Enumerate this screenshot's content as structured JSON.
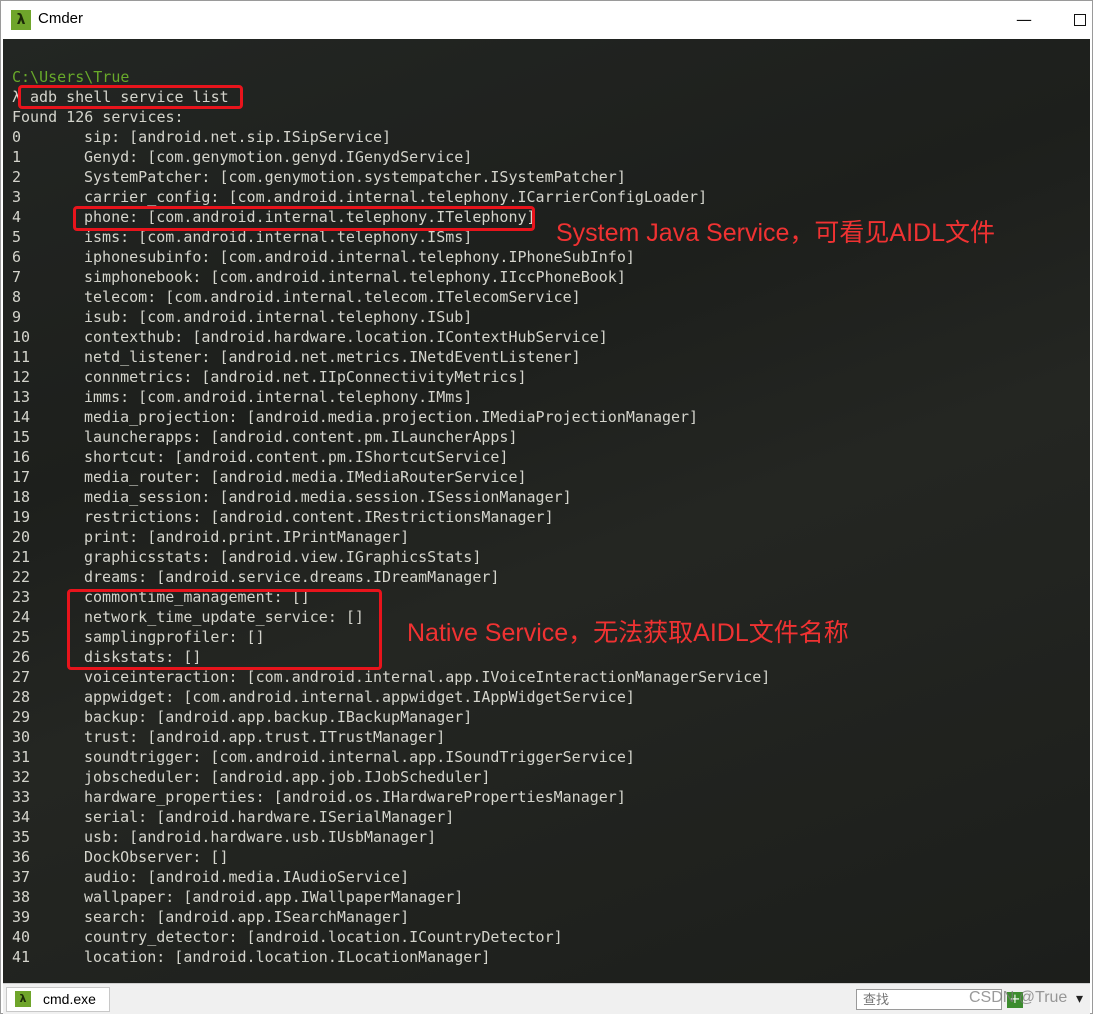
{
  "window": {
    "title": "Cmder",
    "app_icon_glyph": "λ",
    "minimize_glyph": "—"
  },
  "console": {
    "path_line": "C:\\Users\\True",
    "prompt": "λ",
    "command": "adb shell service list",
    "found_line": "Found 126 services:",
    "services": [
      {
        "index": "0",
        "text": "sip: [android.net.sip.ISipService]"
      },
      {
        "index": "1",
        "text": "Genyd: [com.genymotion.genyd.IGenydService]"
      },
      {
        "index": "2",
        "text": "SystemPatcher: [com.genymotion.systempatcher.ISystemPatcher]"
      },
      {
        "index": "3",
        "text": "carrier_config: [com.android.internal.telephony.ICarrierConfigLoader]"
      },
      {
        "index": "4",
        "text": "phone: [com.android.internal.telephony.ITelephony]"
      },
      {
        "index": "5",
        "text": "isms: [com.android.internal.telephony.ISms]"
      },
      {
        "index": "6",
        "text": "iphonesubinfo: [com.android.internal.telephony.IPhoneSubInfo]"
      },
      {
        "index": "7",
        "text": "simphonebook: [com.android.internal.telephony.IIccPhoneBook]"
      },
      {
        "index": "8",
        "text": "telecom: [com.android.internal.telecom.ITelecomService]"
      },
      {
        "index": "9",
        "text": "isub: [com.android.internal.telephony.ISub]"
      },
      {
        "index": "10",
        "text": "contexthub: [android.hardware.location.IContextHubService]"
      },
      {
        "index": "11",
        "text": "netd_listener: [android.net.metrics.INetdEventListener]"
      },
      {
        "index": "12",
        "text": "connmetrics: [android.net.IIpConnectivityMetrics]"
      },
      {
        "index": "13",
        "text": "imms: [com.android.internal.telephony.IMms]"
      },
      {
        "index": "14",
        "text": "media_projection: [android.media.projection.IMediaProjectionManager]"
      },
      {
        "index": "15",
        "text": "launcherapps: [android.content.pm.ILauncherApps]"
      },
      {
        "index": "16",
        "text": "shortcut: [android.content.pm.IShortcutService]"
      },
      {
        "index": "17",
        "text": "media_router: [android.media.IMediaRouterService]"
      },
      {
        "index": "18",
        "text": "media_session: [android.media.session.ISessionManager]"
      },
      {
        "index": "19",
        "text": "restrictions: [android.content.IRestrictionsManager]"
      },
      {
        "index": "20",
        "text": "print: [android.print.IPrintManager]"
      },
      {
        "index": "21",
        "text": "graphicsstats: [android.view.IGraphicsStats]"
      },
      {
        "index": "22",
        "text": "dreams: [android.service.dreams.IDreamManager]"
      },
      {
        "index": "23",
        "text": "commontime_management: []"
      },
      {
        "index": "24",
        "text": "network_time_update_service: []"
      },
      {
        "index": "25",
        "text": "samplingprofiler: []"
      },
      {
        "index": "26",
        "text": "diskstats: []"
      },
      {
        "index": "27",
        "text": "voiceinteraction: [com.android.internal.app.IVoiceInteractionManagerService]"
      },
      {
        "index": "28",
        "text": "appwidget: [com.android.internal.appwidget.IAppWidgetService]"
      },
      {
        "index": "29",
        "text": "backup: [android.app.backup.IBackupManager]"
      },
      {
        "index": "30",
        "text": "trust: [android.app.trust.ITrustManager]"
      },
      {
        "index": "31",
        "text": "soundtrigger: [com.android.internal.app.ISoundTriggerService]"
      },
      {
        "index": "32",
        "text": "jobscheduler: [android.app.job.IJobScheduler]"
      },
      {
        "index": "33",
        "text": "hardware_properties: [android.os.IHardwarePropertiesManager]"
      },
      {
        "index": "34",
        "text": "serial: [android.hardware.ISerialManager]"
      },
      {
        "index": "35",
        "text": "usb: [android.hardware.usb.IUsbManager]"
      },
      {
        "index": "36",
        "text": "DockObserver: []"
      },
      {
        "index": "37",
        "text": "audio: [android.media.IAudioService]"
      },
      {
        "index": "38",
        "text": "wallpaper: [android.app.IWallpaperManager]"
      },
      {
        "index": "39",
        "text": "search: [android.app.ISearchManager]"
      },
      {
        "index": "40",
        "text": "country_detector: [android.location.ICountryDetector]"
      },
      {
        "index": "41",
        "text": "location: [android.location.ILocationManager]"
      }
    ]
  },
  "annotations": {
    "java_service": "System Java Service，可看见AIDL文件",
    "native_service": "Native Service，无法获取AIDL文件名称",
    "box_color": "#e8141c"
  },
  "statusbar": {
    "tab_label": "cmd.exe",
    "search_placeholder": "查找",
    "watermark": "CSDN @True",
    "dropdown_glyph": "▾"
  }
}
